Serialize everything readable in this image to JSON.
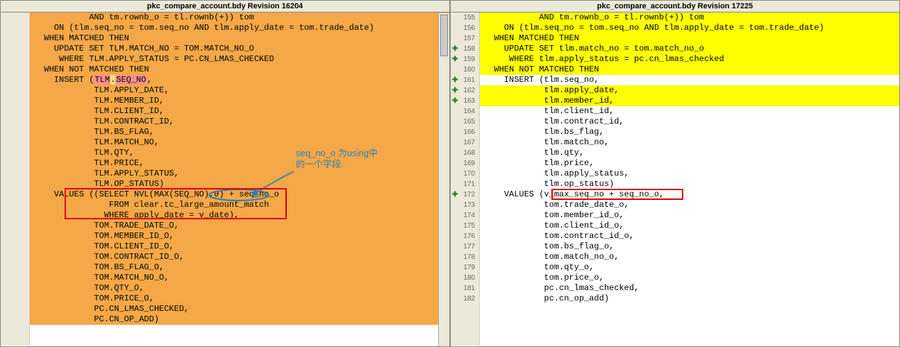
{
  "left": {
    "title": "pkc_compare_account.bdy Revision 16204",
    "lines": [
      {
        "bg": "orange",
        "text": "           AND tm.rownb_o = tl.rownb(+)) tom"
      },
      {
        "bg": "orange",
        "text": "    ON (tlm.seq_no = tom.seq_no AND tlm.apply_date = tom.trade_date)"
      },
      {
        "bg": "orange",
        "text": "  WHEN MATCHED THEN"
      },
      {
        "bg": "orange",
        "text": "    UPDATE SET TLM.MATCH_NO = TOM.MATCH_NO_O"
      },
      {
        "bg": "orange",
        "text": "     WHERE TLM.APPLY_STATUS = PC.CN_LMAS_CHECKED"
      },
      {
        "bg": "orange",
        "text": "  WHEN NOT MATCHED THEN"
      },
      {
        "bg": "orange",
        "insert": true,
        "text": "    INSERT (",
        "hl1": "TLM",
        "dot": ".",
        "hl2": "SEQ_NO",
        "tail": ","
      },
      {
        "bg": "orange",
        "text": "            TLM.APPLY_DATE,"
      },
      {
        "bg": "orange",
        "text": "            TLM.MEMBER_ID,"
      },
      {
        "bg": "orange",
        "text": "            TLM.CLIENT_ID,"
      },
      {
        "bg": "orange",
        "text": "            TLM.CONTRACT_ID,"
      },
      {
        "bg": "orange",
        "text": "            TLM.BS_FLAG,"
      },
      {
        "bg": "orange",
        "text": "            TLM.MATCH_NO,"
      },
      {
        "bg": "orange",
        "text": "            TLM.QTY,"
      },
      {
        "bg": "orange",
        "text": "            TLM.PRICE,"
      },
      {
        "bg": "orange",
        "text": "            TLM.APPLY_STATUS,"
      },
      {
        "bg": "orange",
        "text": "            TLM.OP_STATUS)"
      },
      {
        "bg": "orange",
        "text": "    VALUES ((SELECT NVL(MAX(SEQ_NO),0) + seq_no_o"
      },
      {
        "bg": "orange",
        "text": "               FROM clear.tc_large_amount_match"
      },
      {
        "bg": "orange",
        "text": "              WHERE apply_date = v_date),"
      },
      {
        "bg": "orange",
        "text": "            TOM.TRADE_DATE_O,"
      },
      {
        "bg": "orange",
        "text": "            TOM.MEMBER_ID_O,"
      },
      {
        "bg": "orange",
        "text": "            TOM.CLIENT_ID_O,"
      },
      {
        "bg": "orange",
        "text": "            TOM.CONTRACT_ID_O,"
      },
      {
        "bg": "orange",
        "text": "            TOM.BS_FLAG_O,"
      },
      {
        "bg": "orange",
        "text": "            TOM.MATCH_NO_O,"
      },
      {
        "bg": "orange",
        "text": "            TOM.QTY_O,"
      },
      {
        "bg": "orange",
        "text": "            TOM.PRICE_O,"
      },
      {
        "bg": "orange",
        "text": "            PC.CN_LMAS_CHECKED,"
      },
      {
        "bg": "orange",
        "text": "            PC.CN_OP_ADD)"
      }
    ]
  },
  "right": {
    "title": "pkc_compare_account.bdy Revision 17225",
    "lines": [
      {
        "num": 155,
        "bg": "yellow",
        "text": "           AND tm.rownb_o = tl.rownb(+)) tom"
      },
      {
        "num": 156,
        "bg": "yellow",
        "text": "    ON (tlm.seq_no = tom.seq_no AND tlm.apply_date = tom.trade_date)"
      },
      {
        "num": 157,
        "bg": "yellow",
        "text": "  WHEN MATCHED THEN"
      },
      {
        "num": 158,
        "bg": "yellow",
        "plus": true,
        "text": "    UPDATE SET tlm.match_no = tom.match_no_o"
      },
      {
        "num": 159,
        "bg": "yellow",
        "plus": true,
        "text": "     WHERE tlm.apply_status = pc.cn_lmas_checked"
      },
      {
        "num": 160,
        "bg": "yellow",
        "text": "  WHEN NOT MATCHED THEN"
      },
      {
        "num": 161,
        "bg": "white",
        "plus": true,
        "text": "    INSERT (tlm.seq_no,"
      },
      {
        "num": 162,
        "bg": "yellow",
        "plus": true,
        "text": "            tlm.apply_date,"
      },
      {
        "num": 163,
        "bg": "yellow",
        "plus": true,
        "text": "            tlm.member_id,"
      },
      {
        "num": 164,
        "bg": "white",
        "text": "            tlm.client_id,"
      },
      {
        "num": 165,
        "bg": "white",
        "text": "            tlm.contract_id,"
      },
      {
        "num": 166,
        "bg": "white",
        "text": "            tlm.bs_flag,"
      },
      {
        "num": 167,
        "bg": "white",
        "text": "            tlm.match_no,"
      },
      {
        "num": 168,
        "bg": "white",
        "text": "            tlm.qty,"
      },
      {
        "num": 169,
        "bg": "white",
        "text": "            tlm.price,"
      },
      {
        "num": 170,
        "bg": "white",
        "text": "            tlm.apply_status,"
      },
      {
        "num": 171,
        "bg": "white",
        "text": "            tlm.op_status)"
      },
      {
        "num": 172,
        "bg": "white",
        "plus": true,
        "text": "    VALUES (v_max_seq_no + seq_no_o,"
      },
      {
        "num": 173,
        "bg": "white",
        "text": "            tom.trade_date_o,"
      },
      {
        "num": 174,
        "bg": "white",
        "text": "            tom.member_id_o,"
      },
      {
        "num": 175,
        "bg": "white",
        "text": "            tom.client_id_o,"
      },
      {
        "num": 176,
        "bg": "white",
        "text": "            tom.contract_id_o,"
      },
      {
        "num": 177,
        "bg": "white",
        "text": "            tom.bs_flag_o,"
      },
      {
        "num": 178,
        "bg": "white",
        "text": "            tom.match_no_o,"
      },
      {
        "num": 179,
        "bg": "white",
        "text": "            tom.qty_o,"
      },
      {
        "num": 180,
        "bg": "white",
        "text": "            tom.price_o,"
      },
      {
        "num": 181,
        "bg": "white",
        "text": "            pc.cn_lmas_checked,"
      },
      {
        "num": 182,
        "bg": "white",
        "text": "            pc.cn_op_add)"
      }
    ]
  },
  "annotation": {
    "text1": "seq_no_o 为using中",
    "text2": "的一个字段"
  },
  "colors": {
    "orange": "#f4a847",
    "yellow": "#ffff00",
    "red": "#e00000",
    "blue_annot": "#2e7eb6"
  }
}
